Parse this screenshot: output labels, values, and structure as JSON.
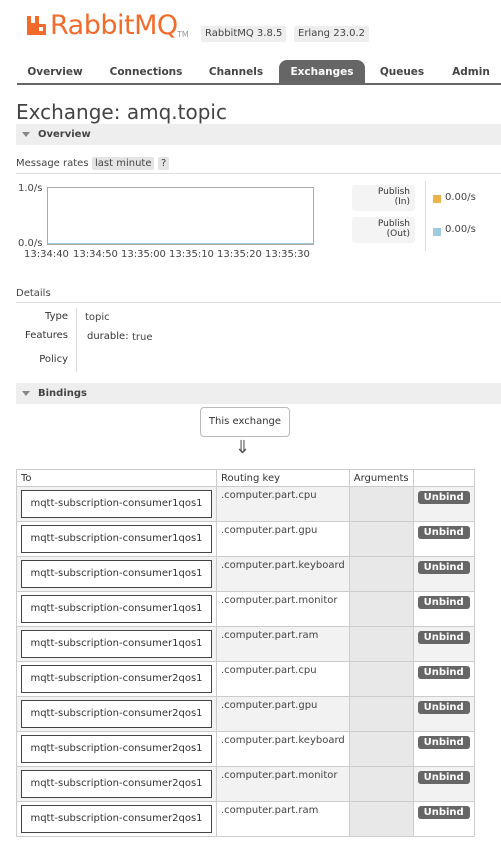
{
  "header": {
    "logo_text": "RabbitMQ",
    "tm": "TM",
    "rabbit_version": "RabbitMQ 3.8.5",
    "erlang_version": "Erlang 23.0.2"
  },
  "tabs": [
    {
      "label": "Overview",
      "active": false
    },
    {
      "label": "Connections",
      "active": false
    },
    {
      "label": "Channels",
      "active": false
    },
    {
      "label": "Exchanges",
      "active": true
    },
    {
      "label": "Queues",
      "active": false
    },
    {
      "label": "Admin",
      "active": false
    }
  ],
  "page": {
    "title_prefix": "Exchange:",
    "title_name": "amq.topic"
  },
  "overview": {
    "heading": "Overview",
    "message_rates_label": "Message rates",
    "range": "last minute",
    "help": "?",
    "y_top": "1.0/s",
    "y_bottom": "0.0/s",
    "ticks": [
      "13:34:40",
      "13:34:50",
      "13:35:00",
      "13:35:10",
      "13:35:20",
      "13:35:30"
    ],
    "legend": [
      {
        "label_1": "Publish",
        "label_2": "(In)",
        "value": "0.00/s",
        "color": "#edb34a"
      },
      {
        "label_1": "Publish",
        "label_2": "(Out)",
        "value": "0.00/s",
        "color": "#9fcbe0"
      }
    ]
  },
  "details": {
    "heading": "Details",
    "type_label": "Type",
    "type_value": "topic",
    "features_label": "Features",
    "durable_label": "durable:",
    "durable_value": "true",
    "policy_label": "Policy"
  },
  "bindings": {
    "heading": "Bindings",
    "this_exchange": "This exchange",
    "arrow": "⇓",
    "columns": [
      "To",
      "Routing key",
      "Arguments",
      ""
    ],
    "unbind_label": "Unbind",
    "rows": [
      {
        "to": "mqtt-subscription-consumer1qos1",
        "key": ".computer.part.cpu"
      },
      {
        "to": "mqtt-subscription-consumer1qos1",
        "key": ".computer.part.gpu"
      },
      {
        "to": "mqtt-subscription-consumer1qos1",
        "key": ".computer.part.keyboard"
      },
      {
        "to": "mqtt-subscription-consumer1qos1",
        "key": ".computer.part.monitor"
      },
      {
        "to": "mqtt-subscription-consumer1qos1",
        "key": ".computer.part.ram"
      },
      {
        "to": "mqtt-subscription-consumer2qos1",
        "key": ".computer.part.cpu"
      },
      {
        "to": "mqtt-subscription-consumer2qos1",
        "key": ".computer.part.gpu"
      },
      {
        "to": "mqtt-subscription-consumer2qos1",
        "key": ".computer.part.keyboard"
      },
      {
        "to": "mqtt-subscription-consumer2qos1",
        "key": ".computer.part.monitor"
      },
      {
        "to": "mqtt-subscription-consumer2qos1",
        "key": ".computer.part.ram"
      }
    ]
  }
}
